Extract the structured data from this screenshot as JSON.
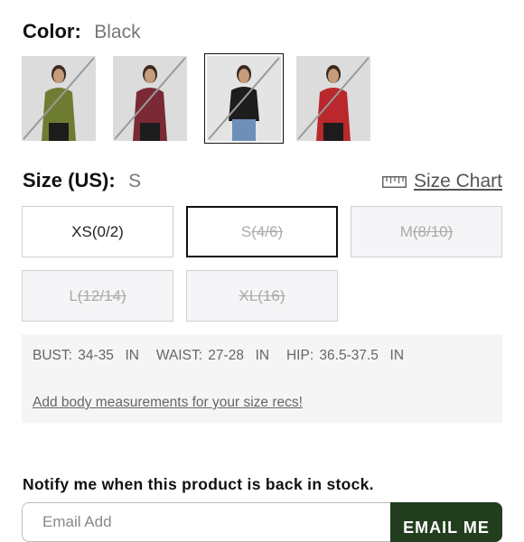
{
  "color": {
    "label": "Color:",
    "selected": "Black",
    "swatches": [
      {
        "name": "Olive",
        "fill": "#6f7d32",
        "available": false,
        "selected": false
      },
      {
        "name": "Burgundy",
        "fill": "#7a2a34",
        "available": false,
        "selected": false
      },
      {
        "name": "Black",
        "fill": "#1d1d1d",
        "available": false,
        "selected": true
      },
      {
        "name": "Red",
        "fill": "#b8282c",
        "available": false,
        "selected": false
      }
    ]
  },
  "size": {
    "label": "Size (US):",
    "selected": "S",
    "size_chart_label": "Size Chart",
    "options": [
      {
        "label": "XS(0/2)",
        "main": "XS",
        "sub": "(0/2)",
        "available": true,
        "selected": false
      },
      {
        "label": "S(4/6)",
        "main": "S",
        "sub": "(4/6)",
        "available": false,
        "selected": true
      },
      {
        "label": "M(8/10)",
        "main": "M",
        "sub": "(8/10)",
        "available": false,
        "selected": false
      },
      {
        "label": "L(12/14)",
        "main": "L",
        "sub": "(12/14)",
        "available": false,
        "selected": false
      },
      {
        "label": "XL(16)",
        "main": "XL",
        "sub": "(16)",
        "available": false,
        "selected": false
      }
    ]
  },
  "measurements": {
    "text": "BUST: 34-35  IN   WAIST: 27-28  IN   HIP: 36.5-37.5  IN",
    "link": "Add body measurements for your size recs!"
  },
  "notify": {
    "title": "Notify me when this product is back in stock.",
    "email_placeholder": "Email Add",
    "button_label": "EMAIL ME"
  },
  "colors": {
    "accent": "#233d1f",
    "unavailable_bg": "#f5f5f7",
    "text_muted": "#777777"
  }
}
